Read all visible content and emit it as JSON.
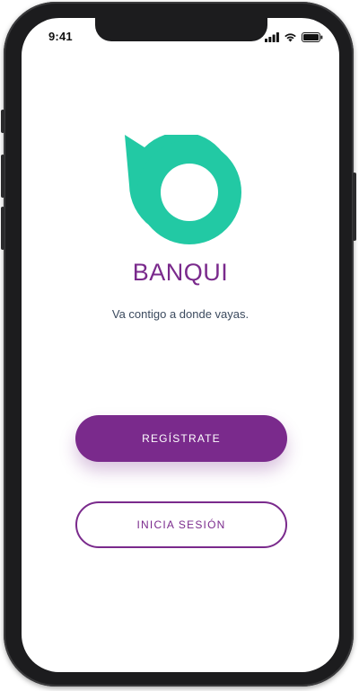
{
  "status_bar": {
    "time": "9:41",
    "icons": [
      "signal-icon",
      "wifi-icon",
      "battery-icon"
    ]
  },
  "app": {
    "brand_name": "BANQUI",
    "tagline": "Va contigo a donde vayas.",
    "logo_icon": "banqui-logo-icon"
  },
  "actions": {
    "register_label": "REGÍSTRATE",
    "login_label": "INICIA SESIÓN"
  },
  "colors": {
    "primary": "#7a2a8c",
    "logo": "#22c9a4",
    "tagline": "#3b4a5e",
    "frame": "#1c1c1e"
  }
}
